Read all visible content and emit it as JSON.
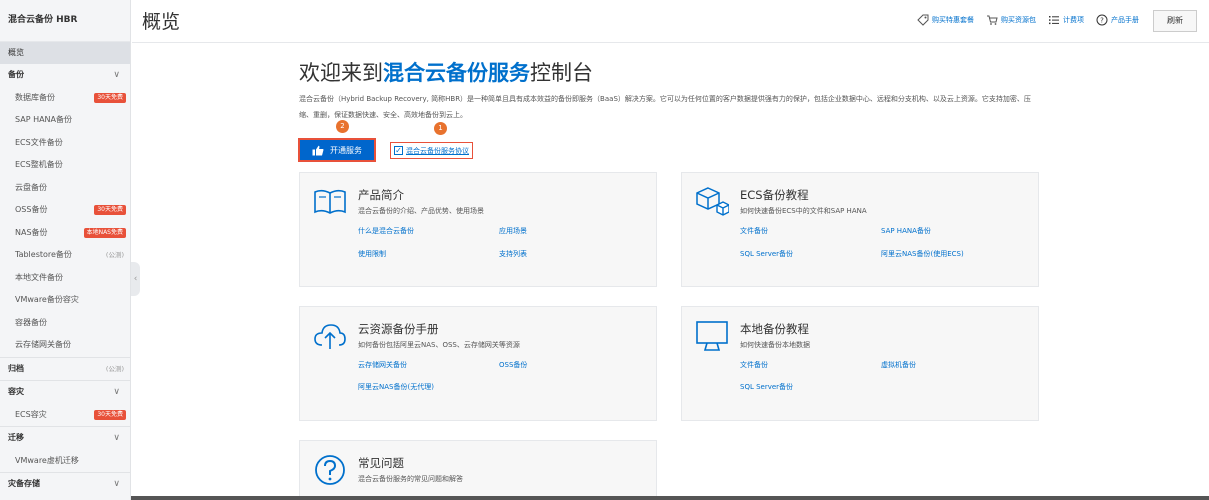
{
  "sidebar": {
    "title": "混合云备份 HBR",
    "overview": "概览",
    "items": [
      {
        "label": "备份",
        "type": "group",
        "chev": "∨"
      },
      {
        "label": "数据库备份",
        "badge": "30天免费"
      },
      {
        "label": "SAP HANA备份"
      },
      {
        "label": "ECS文件备份"
      },
      {
        "label": "ECS整机备份"
      },
      {
        "label": "云盘备份"
      },
      {
        "label": "OSS备份",
        "badge": "30天免费"
      },
      {
        "label": "NAS备份",
        "badge": "本地NAS免费"
      },
      {
        "label": "Tablestore备份",
        "tag": "(公测)"
      },
      {
        "label": "本地文件备份"
      },
      {
        "label": "VMware备份容灾"
      },
      {
        "label": "容器备份"
      },
      {
        "label": "云存储网关备份"
      },
      {
        "label": "归档",
        "type": "group",
        "tag": "(公测)"
      },
      {
        "label": "容灾",
        "type": "group",
        "chev": "∨"
      },
      {
        "label": "ECS容灾",
        "badge": "30天免费"
      },
      {
        "label": "迁移",
        "type": "group",
        "chev": "∨"
      },
      {
        "label": "VMware虚机迁移"
      },
      {
        "label": "灾备存储",
        "type": "group",
        "chev": "∨"
      }
    ]
  },
  "header": {
    "title": "概览",
    "links": [
      {
        "label": "购买特惠套餐",
        "icon": "tag-icon"
      },
      {
        "label": "购买资源包",
        "icon": "cart-icon"
      },
      {
        "label": "计费项",
        "icon": "list-icon"
      },
      {
        "label": "产品手册",
        "icon": "help-icon"
      }
    ],
    "refresh": "刷新"
  },
  "main": {
    "welcome_pre": "欢迎来到",
    "welcome_brand": "混合云备份服务",
    "welcome_post": "控制台",
    "intro": "混合云备份（Hybrid Backup Recovery, 简称HBR）是一种简单且具有成本效益的备份即服务（BaaS）解决方案。它可以为任何位置的客户数据提供强有力的保护，包括企业数据中心、远程和分支机构、以及云上资源。它支持加密、压缩、重删，保证数据快速、安全、高效地备份到云上。",
    "marker1": "1",
    "marker2": "2",
    "open_button": "开通服务",
    "agreement": "混合云备份服务协议"
  },
  "cards": [
    {
      "title": "产品简介",
      "desc": "混合云备份的介绍、产品优势、使用场景",
      "icon": "book-icon",
      "links": [
        "什么是混合云备份",
        "应用场景",
        "使用限制",
        "支持列表"
      ]
    },
    {
      "title": "ECS备份教程",
      "desc": "如何快速备份ECS中的文件和SAP HANA",
      "icon": "cube-icon",
      "links": [
        "文件备份",
        "SAP HANA备份",
        "SQL Server备份",
        "阿里云NAS备份(使用ECS)"
      ]
    },
    {
      "title": "云资源备份手册",
      "desc": "如何备份包括阿里云NAS、OSS、云存储网关等资源",
      "icon": "cloud-upload-icon",
      "links": [
        "云存储网关备份",
        "OSS备份",
        "阿里云NAS备份(无代理)"
      ]
    },
    {
      "title": "本地备份教程",
      "desc": "如何快速备份本地数据",
      "icon": "monitor-icon",
      "links": [
        "文件备份",
        "虚拟机备份",
        "SQL Server备份"
      ]
    },
    {
      "title": "常见问题",
      "desc": "混合云备份服务的常见问题和解答",
      "icon": "question-icon",
      "links": []
    }
  ],
  "colors": {
    "accent": "#0070cc",
    "primary_button": "#0066cc",
    "highlight": "#e8513a",
    "marker": "#e8722e"
  }
}
